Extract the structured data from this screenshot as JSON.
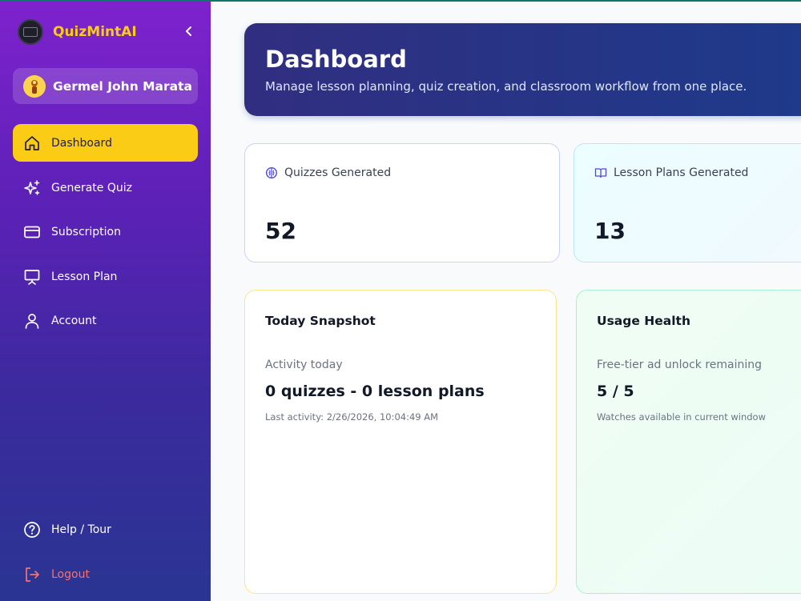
{
  "app": {
    "name": "QuizMintAI"
  },
  "user": {
    "name": "Germel John Marata"
  },
  "sidebar": {
    "items": [
      {
        "label": "Dashboard",
        "icon": "home-icon",
        "active": true
      },
      {
        "label": "Generate Quiz",
        "icon": "sparkles-icon"
      },
      {
        "label": "Subscription",
        "icon": "credit-card-icon"
      },
      {
        "label": "Lesson Plan",
        "icon": "presentation-icon"
      },
      {
        "label": "Account",
        "icon": "user-icon"
      }
    ],
    "bottom": [
      {
        "label": "Help / Tour",
        "icon": "help-circle-icon"
      },
      {
        "label": "Logout",
        "icon": "logout-icon"
      }
    ]
  },
  "header": {
    "title": "Dashboard",
    "subtitle": "Manage lesson planning, quiz creation, and classroom workflow from one place."
  },
  "stats": [
    {
      "label": "Quizzes Generated",
      "value": "52",
      "icon": "brain-icon"
    },
    {
      "label": "Lesson Plans Generated",
      "value": "13",
      "icon": "book-open-icon"
    }
  ],
  "snapshot": {
    "title": "Today Snapshot",
    "subtitle": "Activity today",
    "value": "0 quizzes - 0 lesson plans",
    "note": "Last activity: 2/26/2026, 10:04:49 AM"
  },
  "health": {
    "title": "Usage Health",
    "subtitle": "Free-tier ad unlock remaining",
    "value": "5 / 5",
    "note": "Watches available in current window"
  },
  "colors": {
    "accent": "#facc15",
    "sidebar_top": "#7e22ce",
    "sidebar_bottom": "#2a3592",
    "hero": "#312e81",
    "logout": "#f87171"
  }
}
